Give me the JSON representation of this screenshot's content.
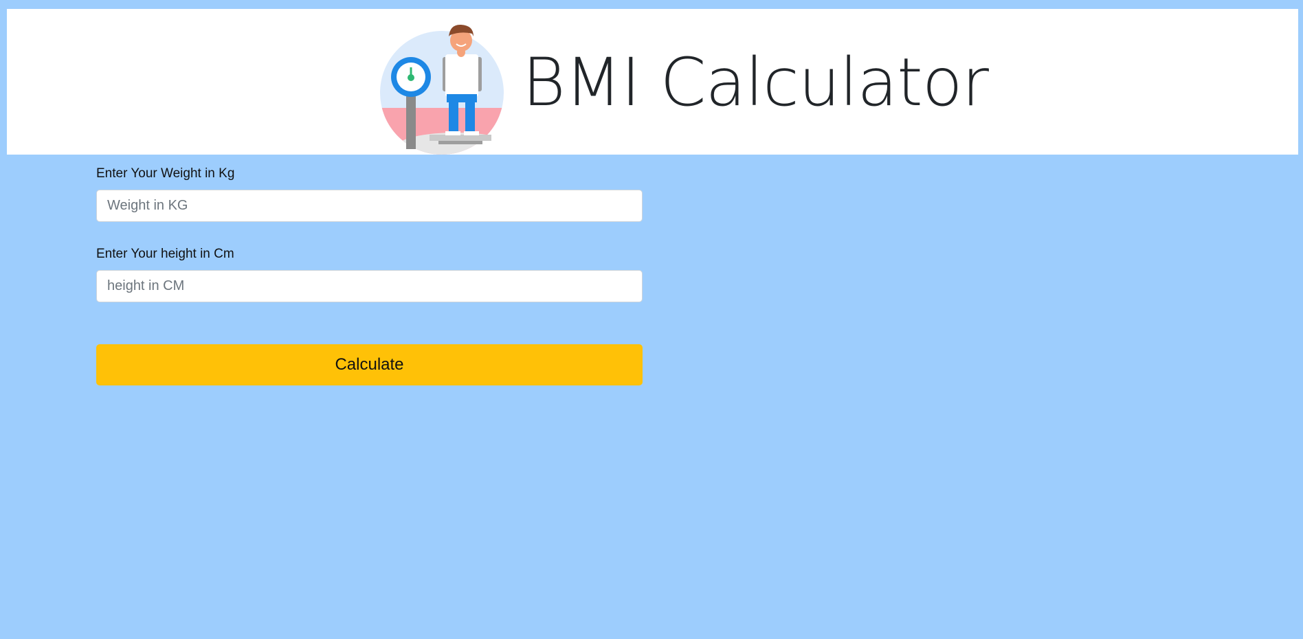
{
  "header": {
    "title": "BMI Calculator",
    "logo_icon": "person-on-scale-icon"
  },
  "form": {
    "weight_label": "Enter Your Weight in Kg",
    "weight_placeholder": "Weight in KG",
    "weight_value": "",
    "height_label": "Enter Your height in Cm",
    "height_placeholder": "height in CM",
    "height_value": "",
    "calculate_label": "Calculate"
  },
  "colors": {
    "page_background": "#9dcdfd",
    "header_background": "#ffffff",
    "button_background": "#ffc107"
  }
}
